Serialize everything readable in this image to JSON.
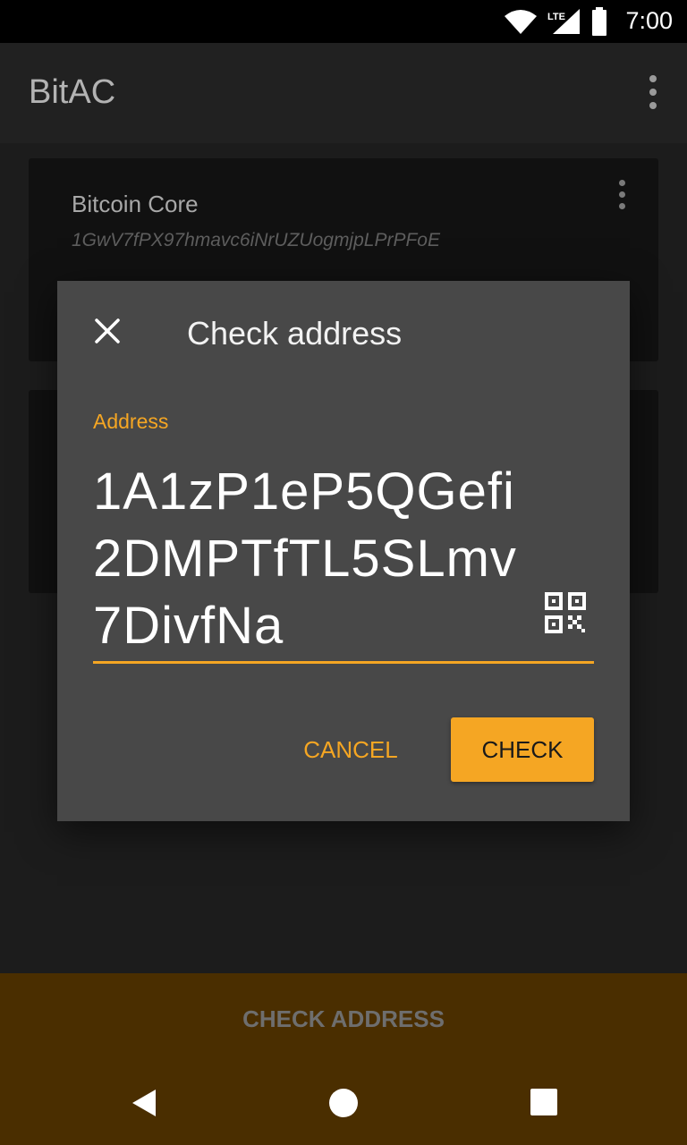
{
  "status_bar": {
    "time": "7:00",
    "network": "LTE"
  },
  "app_bar": {
    "title": "BitAC"
  },
  "cards": [
    {
      "title": "Bitcoin Core",
      "address": "1GwV7fPX97hmavc6iNrUZUogmjpLPrPFoE"
    }
  ],
  "dialog": {
    "title": "Check address",
    "field_label": "Address",
    "field_value": "1A1zP1eP5QGefi2DMPTfTL5SLmv7DivfNa",
    "cancel_label": "CANCEL",
    "check_label": "CHECK"
  },
  "bottom_action": {
    "label": "CHECK ADDRESS"
  },
  "colors": {
    "accent": "#f5a623",
    "dialog_bg": "#484848",
    "bottom_bar": "#4a2e00"
  }
}
